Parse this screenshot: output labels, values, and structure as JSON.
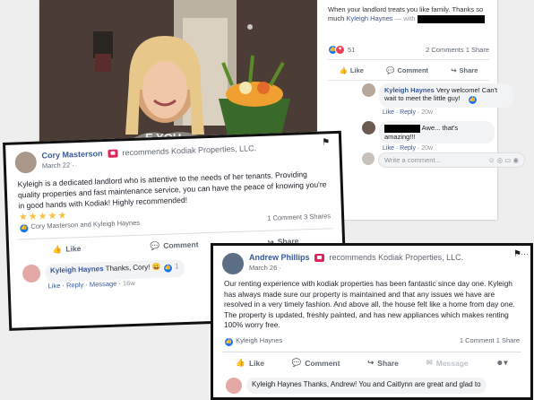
{
  "photo_post": {
    "text": "When your landlord treats you like family. Thanks so much",
    "tag_name": "Kyleigh Haynes",
    "with_label": "with",
    "reaction_count": "51",
    "comments_count": "2 Comments",
    "shares_count": "1 Share",
    "actions": {
      "like": "Like",
      "comment": "Comment",
      "share": "Share"
    },
    "sweater_text": "E YOU",
    "comments": [
      {
        "name": "Kyleigh Haynes",
        "text": "Very welcome! Can't wait to meet the little guy!",
        "like": "Like",
        "reply": "Reply",
        "time": "20w",
        "reactions": "1"
      },
      {
        "name": "",
        "text": "Awe... that's amazing!!!",
        "like": "Like",
        "reply": "Reply",
        "time": "20w"
      }
    ],
    "write_placeholder": "Write a comment..."
  },
  "review1": {
    "name": "Cory Masterson",
    "recommends": "recommends Kodiak Properties, LLC.",
    "date": "March 22 ·",
    "text": "Kyleigh is a dedicated landlord who is attentive to the needs of her tenants. Providing quality properties and fast maintenance service, you can have the peace of knowing you're in good hands with Kodiak! Highly recommended!",
    "stars": "★★★★★",
    "likers": "Cory Masterson and Kyleigh Haynes",
    "comment_count": "1 Comment",
    "share_count": "3 Shares",
    "actions": {
      "like": "Like",
      "comment": "Comment",
      "share": "Share"
    },
    "reply": {
      "name": "Kyleigh Haynes",
      "text": "Thanks, Cory!",
      "reactions": "1",
      "like": "Like",
      "reply": "Reply",
      "message": "Message",
      "time": "16w"
    }
  },
  "review2": {
    "name": "Andrew Phillips",
    "recommends": "recommends Kodiak Properties, LLC.",
    "date": "March 26 ·",
    "text": "Our renting experience with kodiak properties has been fantastic since day one. Kyleigh has always made sure our property is maintained and that any issues we have are resolved in a very timely fashion. And above all, the house felt like a home from day one. The property is updated, freshly painted, and has new appliances which makes renting 100% worry free.",
    "likers": "Kyleigh Haynes",
    "comment_count": "1 Comment",
    "share_count": "1 Share",
    "actions": {
      "like": "Like",
      "comment": "Comment",
      "share": "Share",
      "message": "Message"
    },
    "reply": {
      "text": "Kyleigh Haynes Thanks, Andrew! You and Caitlynn are great and glad to"
    }
  },
  "colors": {
    "link": "#385898",
    "star": "#f5c33b",
    "badge": "#e0245e"
  }
}
